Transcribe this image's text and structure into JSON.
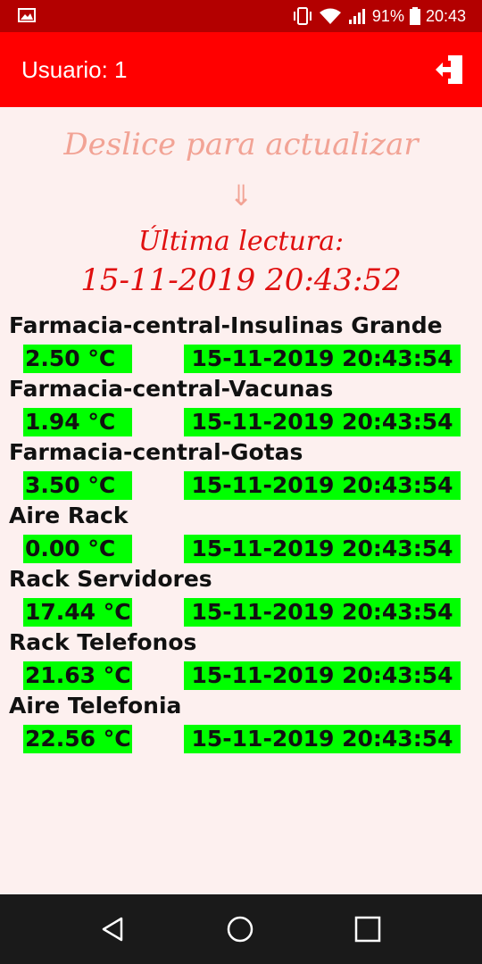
{
  "status_bar": {
    "battery": "91%",
    "time": "20:43",
    "icons": [
      "image-icon",
      "vibrate-icon",
      "wifi-icon",
      "signal-icon",
      "battery-icon"
    ]
  },
  "app_bar": {
    "title": "Usuario: 1",
    "action_icon": "logout-icon",
    "colors": {
      "app_bar": "#ff0000",
      "status_bar": "#b30000"
    }
  },
  "refresh": {
    "hint": "Deslice para actualizar",
    "arrow": "⇓",
    "last_label": "Última lectura:",
    "last_time": "15-11-2019 20:43:52"
  },
  "readings": [
    {
      "name": "Farmacia-central-Insulinas Grande",
      "temp": "2.50  °C",
      "time": "15-11-2019 20:43:54"
    },
    {
      "name": "Farmacia-central-Vacunas",
      "temp": "1.94  °C",
      "time": "15-11-2019 20:43:54"
    },
    {
      "name": "Farmacia-central-Gotas",
      "temp": "3.50  °C",
      "time": "15-11-2019 20:43:54"
    },
    {
      "name": "Aire Rack",
      "temp": "0.00  °C",
      "time": "15-11-2019 20:43:54"
    },
    {
      "name": "Rack Servidores",
      "temp": "17.44 °C",
      "time": "15-11-2019 20:43:54"
    },
    {
      "name": "Rack Telefonos",
      "temp": "21.63 °C",
      "time": "15-11-2019 20:43:54"
    },
    {
      "name": "Aire Telefonia",
      "temp": "22.56 °C",
      "time": "15-11-2019 20:43:54"
    }
  ],
  "reading_highlight_color": "#00ff00",
  "nav_bar": {
    "icons": [
      "back-icon",
      "home-icon",
      "recents-icon"
    ]
  }
}
